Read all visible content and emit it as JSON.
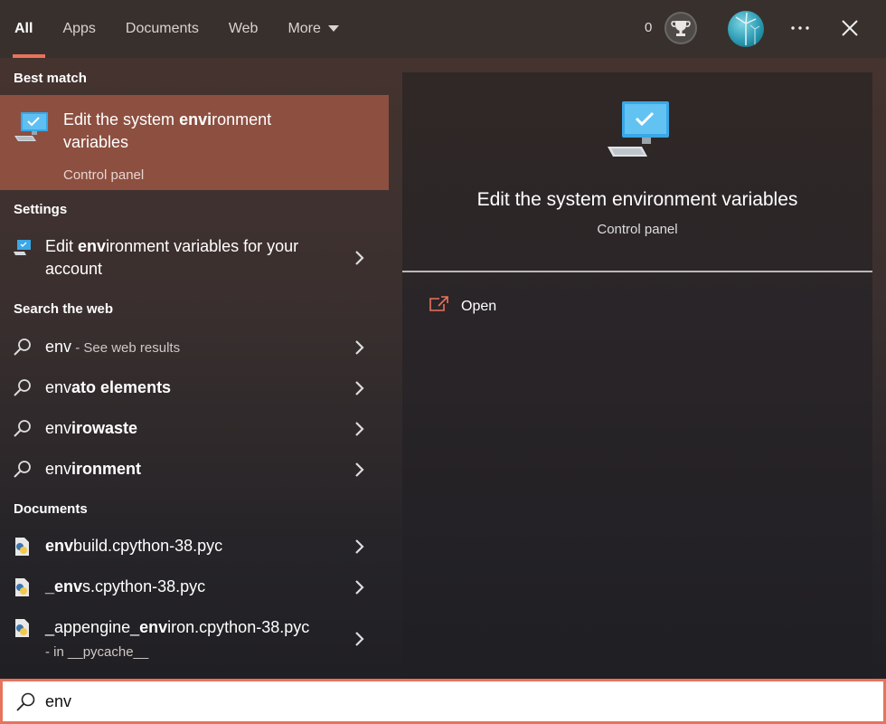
{
  "nav": {
    "tabs": [
      {
        "label": "All"
      },
      {
        "label": "Apps"
      },
      {
        "label": "Documents"
      },
      {
        "label": "Web"
      },
      {
        "label": "More"
      }
    ],
    "points": "0"
  },
  "left": {
    "best_match_heading": "Best match",
    "best": {
      "title_pre": "Edit the system ",
      "title_bold": "envi",
      "title_post": "ronment variables",
      "subtitle": "Control panel"
    },
    "settings_heading": "Settings",
    "settings_item": {
      "pre": "Edit ",
      "bold": "env",
      "post": "ironment variables for your",
      "line2": "account"
    },
    "web_heading": "Search the web",
    "web_items": [
      {
        "pre": "env",
        "bold": "",
        "suffix": " - See web results"
      },
      {
        "pre": "env",
        "bold": "ato elements",
        "suffix": ""
      },
      {
        "pre": "env",
        "bold": "irowaste",
        "suffix": ""
      },
      {
        "pre": "env",
        "bold": "ironment",
        "suffix": ""
      }
    ],
    "docs_heading": "Documents",
    "doc_items": [
      {
        "pre": "",
        "bold": "env",
        "post": "build.cpython-38.pyc",
        "sub": ""
      },
      {
        "pre": "",
        "bold": "_env",
        "post": "s.cpython-38.pyc",
        "sub": ""
      },
      {
        "pre": "_appengine_",
        "bold": "env",
        "post": "iron.cpython-38.pyc",
        "sub": "- in __pycache__"
      }
    ]
  },
  "preview": {
    "title": "Edit the system environment variables",
    "subtitle": "Control panel",
    "open_label": "Open"
  },
  "search": {
    "value": "env"
  },
  "colors": {
    "accent": "#e8735c",
    "best_match_bg": "#8d4f40",
    "monitor_blue": "#3aa7e6"
  }
}
